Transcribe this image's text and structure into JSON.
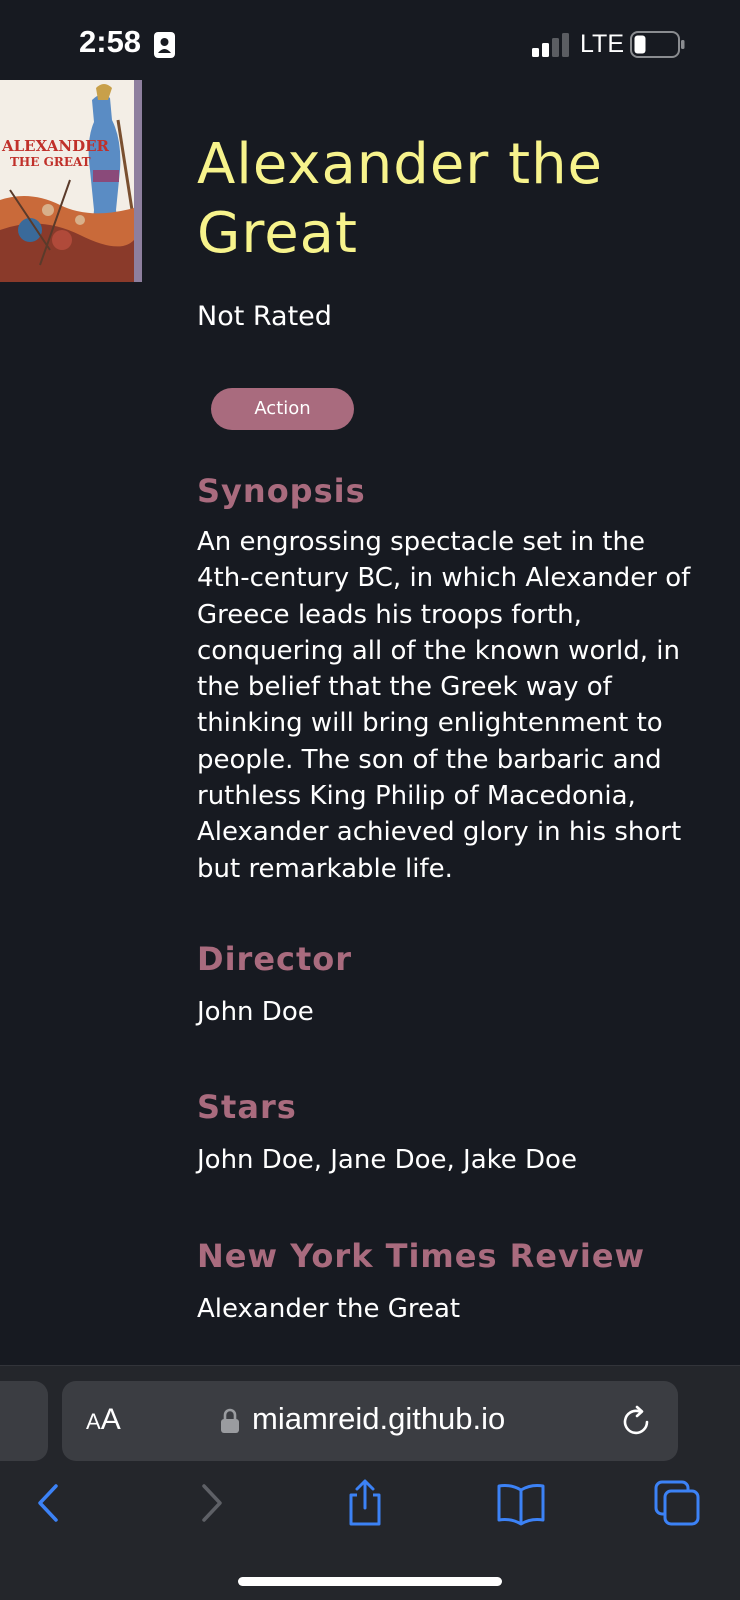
{
  "status": {
    "time": "2:58",
    "network": "LTE"
  },
  "poster": {
    "title_line1": "ALEXANDER",
    "title_line2": "THE GREAT"
  },
  "movie": {
    "title": "Alexander the Great",
    "rating": "Not Rated",
    "genre": "Action",
    "synopsis_label": "Synopsis",
    "synopsis": "An engrossing spectacle set in the 4th-century BC, in which Alexander of Greece leads his troops forth, conquering all of the known world, in the belief that the Greek way of thinking will bring enlightenment to people. The son of the barbaric and ruthless King Philip of Macedonia, Alexander achieved glory in his short but remarkable life.",
    "director_label": "Director",
    "director": "John Doe",
    "stars_label": "Stars",
    "stars": "John Doe, Jane Doe, Jake Doe",
    "review_label": "New York Times Review",
    "review_title": "Alexander the Great"
  },
  "browser": {
    "text_size_small": "A",
    "text_size_large": "A",
    "url": "miamreid.github.io"
  },
  "colors": {
    "background": "#171a21",
    "title": "#f7f38c",
    "accent": "#a96b7e",
    "toolbar": "#24262b",
    "ios_blue": "#3c82f6"
  }
}
